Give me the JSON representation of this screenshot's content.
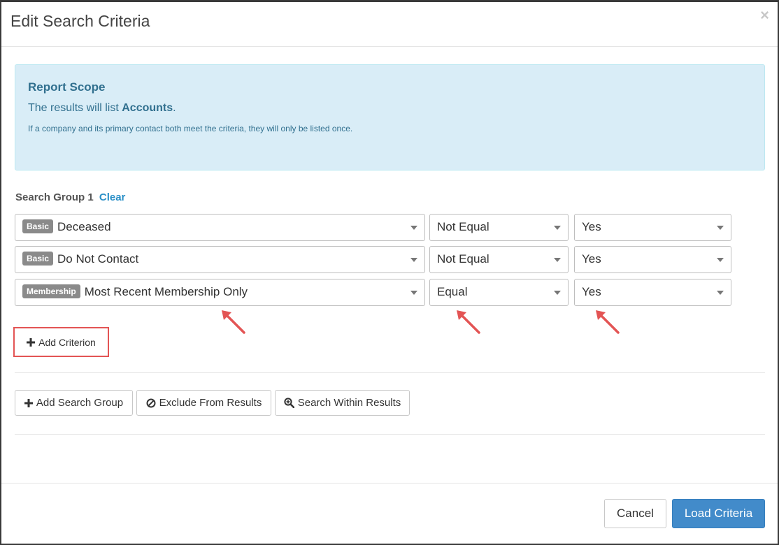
{
  "modal": {
    "title": "Edit Search Criteria",
    "close_glyph": "×"
  },
  "scope": {
    "title": "Report Scope",
    "line_prefix": "The results will list ",
    "line_entity": "Accounts",
    "line_suffix": ".",
    "note": "If a company and its primary contact both meet the criteria, they will only be listed once."
  },
  "group": {
    "title": "Search Group 1",
    "clear_label": "Clear"
  },
  "criteria": [
    {
      "badge": "Basic",
      "field": "Deceased",
      "operator": "Not Equal",
      "value": "Yes"
    },
    {
      "badge": "Basic",
      "field": "Do Not Contact",
      "operator": "Not Equal",
      "value": "Yes"
    },
    {
      "badge": "Membership",
      "field": "Most Recent Membership Only",
      "operator": "Equal",
      "value": "Yes"
    }
  ],
  "actions": {
    "add_criterion": "Add Criterion",
    "add_search_group": "Add Search Group",
    "exclude_from_results": "Exclude From Results",
    "search_within_results": "Search Within Results"
  },
  "footer": {
    "cancel": "Cancel",
    "load_criteria": "Load Criteria"
  },
  "colors": {
    "primary": "#428bca",
    "scope_bg": "#d9edf7",
    "scope_text": "#31708f",
    "highlight": "#e35454",
    "badge_bg": "#8a8a8a"
  }
}
